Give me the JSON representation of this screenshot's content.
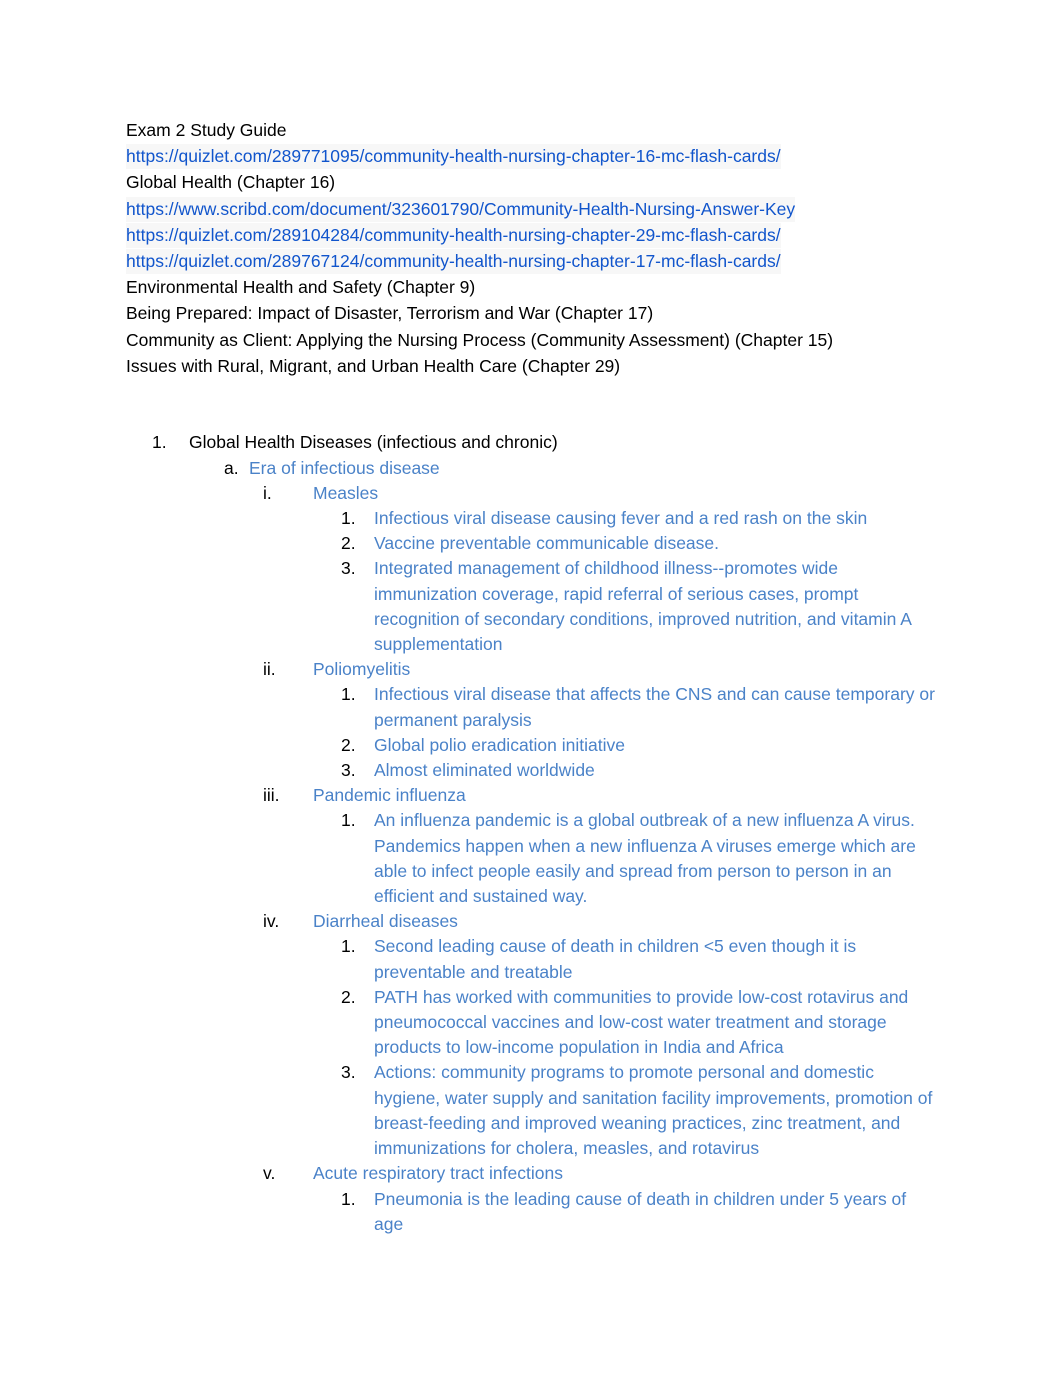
{
  "document": {
    "title": "Exam 2 Study Guide",
    "colors": {
      "link": "#1155cc",
      "outline_text": "#4a82c8",
      "body_text": "#000000",
      "page_background": "#ffffff",
      "link_highlight": "#f7f7f7"
    },
    "header_lines": [
      {
        "text": "Exam 2 Study Guide",
        "kind": "text"
      },
      {
        "text": "https://quizlet.com/289771095/community-health-nursing-chapter-16-mc-flash-cards/",
        "kind": "link"
      },
      {
        "text": "Global Health (Chapter 16)",
        "kind": "text"
      },
      {
        "text": "https://www.scribd.com/document/323601790/Community-Health-Nursing-Answer-Key",
        "kind": "link"
      },
      {
        "text": "https://quizlet.com/289104284/community-health-nursing-chapter-29-mc-flash-cards/",
        "kind": "link"
      },
      {
        "text": "https://quizlet.com/289767124/community-health-nursing-chapter-17-mc-flash-cards/",
        "kind": "link"
      },
      {
        "text": "Environmental Health and Safety (Chapter 9)",
        "kind": "text"
      },
      {
        "text": "Being Prepared: Impact of Disaster, Terrorism and War (Chapter 17)",
        "kind": "text"
      },
      {
        "text": "Community as Client: Applying the Nursing Process (Community Assessment) (Chapter 15)",
        "kind": "text"
      },
      {
        "text": "Issues with Rural, Migrant, and Urban Health Care (Chapter 29)",
        "kind": "text"
      }
    ],
    "outline": {
      "item1": {
        "marker": "1.",
        "text": "Global Health Diseases (infectious and chronic)",
        "sub_a": {
          "marker": "a.",
          "text": "Era of infectious disease",
          "romans": [
            {
              "marker": "i.",
              "text": "Measles",
              "points": [
                {
                  "marker": "1.",
                  "text": "Infectious viral disease causing fever and a red rash on the skin"
                },
                {
                  "marker": "2.",
                  "text": "Vaccine preventable communicable disease."
                },
                {
                  "marker": "3.",
                  "text": "Integrated management of childhood illness--promotes wide immunization coverage, rapid referral of serious cases, prompt recognition of secondary conditions, improved nutrition, and vitamin A supplementation"
                }
              ]
            },
            {
              "marker": "ii.",
              "text": "Poliomyelitis",
              "points": [
                {
                  "marker": "1.",
                  "text": "Infectious viral disease that affects the CNS and can cause temporary or permanent paralysis"
                },
                {
                  "marker": "2.",
                  "text": "Global polio eradication initiative"
                },
                {
                  "marker": "3.",
                  "text": "Almost eliminated worldwide"
                }
              ]
            },
            {
              "marker": "iii.",
              "text": "Pandemic influenza",
              "points": [
                {
                  "marker": "1.",
                  "text": "An influenza pandemic is a global outbreak of a new influenza A virus. Pandemics happen when a new influenza A viruses emerge which are able to infect people easily and spread from person to person in an efficient and sustained way."
                }
              ]
            },
            {
              "marker": "iv.",
              "text": "Diarrheal diseases",
              "points": [
                {
                  "marker": "1.",
                  "text": "Second leading cause of death in children <5 even though it is preventable and treatable"
                },
                {
                  "marker": "2.",
                  "text": "PATH has worked with communities to provide low-cost rotavirus and pneumococcal vaccines and low-cost water treatment and storage products to low-income population in India and Africa"
                },
                {
                  "marker": "3.",
                  "text": "Actions: community programs to promote personal and domestic hygiene, water supply and sanitation facility improvements, promotion of breast-feeding and improved weaning practices, zinc treatment, and immunizations for cholera, measles, and rotavirus"
                }
              ]
            },
            {
              "marker": "v.",
              "text": "Acute respiratory tract infections",
              "points": [
                {
                  "marker": "1.",
                  "text": "Pneumonia is the leading cause of death in children under 5 years of age"
                }
              ]
            }
          ]
        }
      }
    }
  }
}
